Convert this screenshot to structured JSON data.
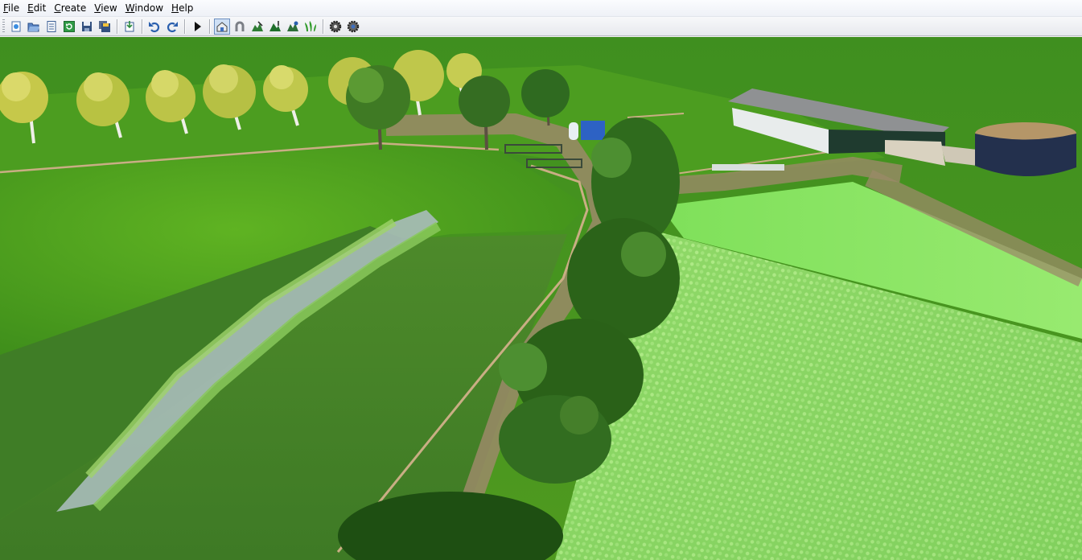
{
  "menu": [
    {
      "label": "File",
      "key": "F"
    },
    {
      "label": "Edit",
      "key": "E"
    },
    {
      "label": "Create",
      "key": "C"
    },
    {
      "label": "View",
      "key": "V"
    },
    {
      "label": "Window",
      "key": "W"
    },
    {
      "label": "Help",
      "key": "H"
    }
  ],
  "toolbar": {
    "icons": [
      "new-icon",
      "open-icon",
      "properties-icon",
      "refresh-icon",
      "save-icon",
      "save-all-icon",
      "import-icon",
      "undo-icon",
      "redo-icon",
      "play-icon",
      "select-object-icon",
      "magnet-icon",
      "terrain-paint-icon",
      "terrain-height-icon",
      "terrain-smooth-icon",
      "foliage-paint-icon",
      "settings-icon",
      "settings-alt-icon"
    ],
    "active": "select-object-icon"
  },
  "colors": {
    "grass_dark": "#3f8f1f",
    "grass_mid": "#55a71f",
    "grass_light": "#7ed957",
    "crop": "#8edc6a",
    "path": "#9b8a68",
    "fence": "#c9ae84",
    "water": "#9fb3b0",
    "shed_roof": "#8f9193",
    "shed_wall": "#1f3b2f",
    "silo": "#23304d"
  }
}
